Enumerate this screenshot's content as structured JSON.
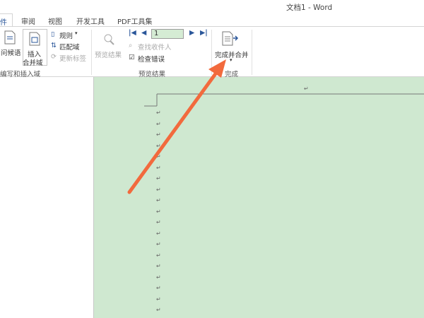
{
  "window": {
    "title": "文档1 - Word"
  },
  "tabs": [
    {
      "label": "件",
      "active": true
    },
    {
      "label": "审阅"
    },
    {
      "label": "视图"
    },
    {
      "label": "开发工具"
    },
    {
      "label": "PDF工具集"
    }
  ],
  "ribbon": {
    "write_insert": {
      "greeting": "问候语",
      "insert_field_1": "插入",
      "insert_field_2": "合并域",
      "rules": "规则",
      "match_fields": "匹配域",
      "update_labels": "更新标签",
      "group_label": "编写和插入域"
    },
    "preview": {
      "preview_results": "预览结果",
      "record_number": "1",
      "find_recipient": "查找收件人",
      "check_errors": "检查错误",
      "group_label": "预览结果"
    },
    "finish": {
      "finish_merge": "完成并合并",
      "group_label": "完成"
    }
  },
  "document": {
    "paragraph_mark": "↵"
  },
  "colors": {
    "accent": "#2b579a",
    "doc_bg": "#cfe8d0",
    "arrow": "#f26a3d"
  }
}
